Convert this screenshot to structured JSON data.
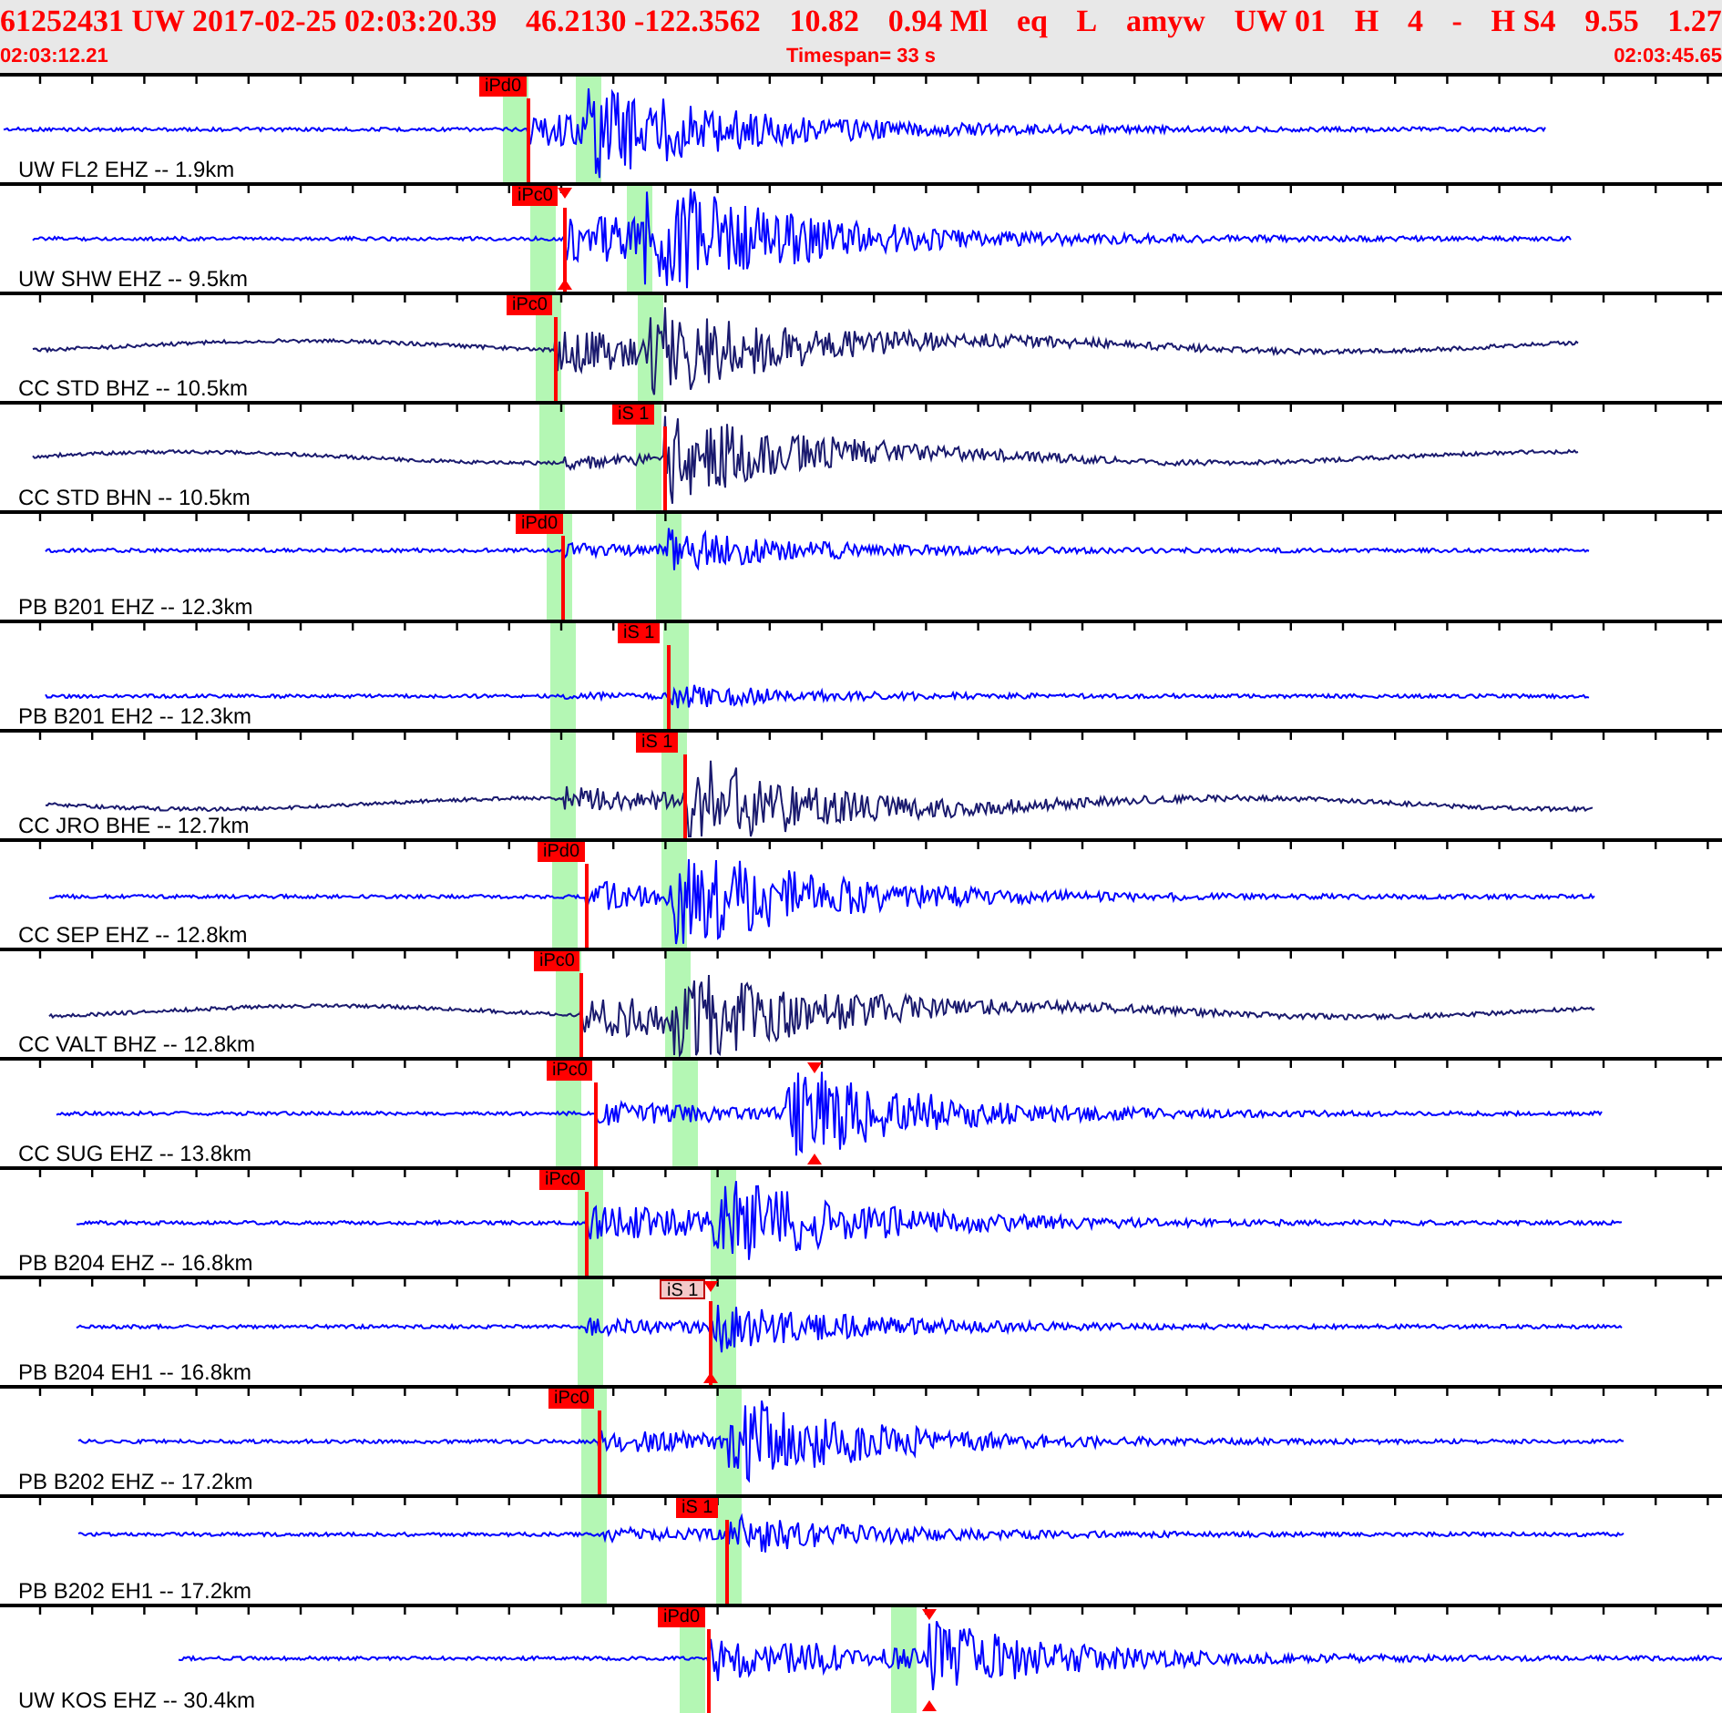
{
  "header": {
    "fields": [
      "61252431",
      "UW",
      "2017-02-25 02:03:20.39",
      "46.2130",
      "-122.3562",
      "10.82",
      "0.94 Ml",
      "eq",
      "L",
      "amyw",
      "UW 01",
      "H",
      "4",
      "-",
      "H S4",
      "9.55",
      "1.27"
    ]
  },
  "time_bar": {
    "start": "02:03:12.21",
    "timespan": "Timespan=  33 s",
    "end": "02:03:45.65"
  },
  "traces": [
    {
      "label": "UW FL2 EHZ -- 1.9km",
      "color": "#0000ff",
      "pick": "iPd0",
      "dimmed": false
    },
    {
      "label": "UW SHW EHZ -- 9.5km",
      "color": "#0000ff",
      "pick": "iPc0",
      "dimmed": false
    },
    {
      "label": "CC STD BHZ -- 10.5km",
      "color": "#1a1a6e",
      "pick": "iPc0",
      "dimmed": false
    },
    {
      "label": "CC STD BHN -- 10.5km",
      "color": "#1a1a6e",
      "pick": "iS 1",
      "dimmed": false
    },
    {
      "label": "PB B201 EHZ -- 12.3km",
      "color": "#0000ff",
      "pick": "iPd0",
      "dimmed": false
    },
    {
      "label": "PB B201 EH2 -- 12.3km",
      "color": "#0000ff",
      "pick": "iS 1",
      "dimmed": false
    },
    {
      "label": "CC JRO BHE -- 12.7km",
      "color": "#1a1a6e",
      "pick": "iS 1",
      "dimmed": false
    },
    {
      "label": "CC SEP EHZ -- 12.8km",
      "color": "#0000ff",
      "pick": "iPd0",
      "dimmed": false
    },
    {
      "label": "CC VALT BHZ -- 12.8km",
      "color": "#1a1a6e",
      "pick": "iPc0",
      "dimmed": false
    },
    {
      "label": "CC SUG EHZ -- 13.8km",
      "color": "#0000ff",
      "pick": "iPc0",
      "dimmed": false
    },
    {
      "label": "PB B204 EHZ -- 16.8km",
      "color": "#0000ff",
      "pick": "iPc0",
      "dimmed": false
    },
    {
      "label": "PB B204 EH1 -- 16.8km",
      "color": "#0000ff",
      "pick": "iS 1",
      "dimmed": true
    },
    {
      "label": "PB B202 EHZ -- 17.2km",
      "color": "#0000ff",
      "pick": "iPc0",
      "dimmed": false
    },
    {
      "label": "PB B202 EH1 -- 17.2km",
      "color": "#0000ff",
      "pick": "iS 1",
      "dimmed": false
    },
    {
      "label": "UW KOS EHZ -- 30.4km",
      "color": "#0000ff",
      "pick": "iPd0",
      "dimmed": false
    }
  ]
}
